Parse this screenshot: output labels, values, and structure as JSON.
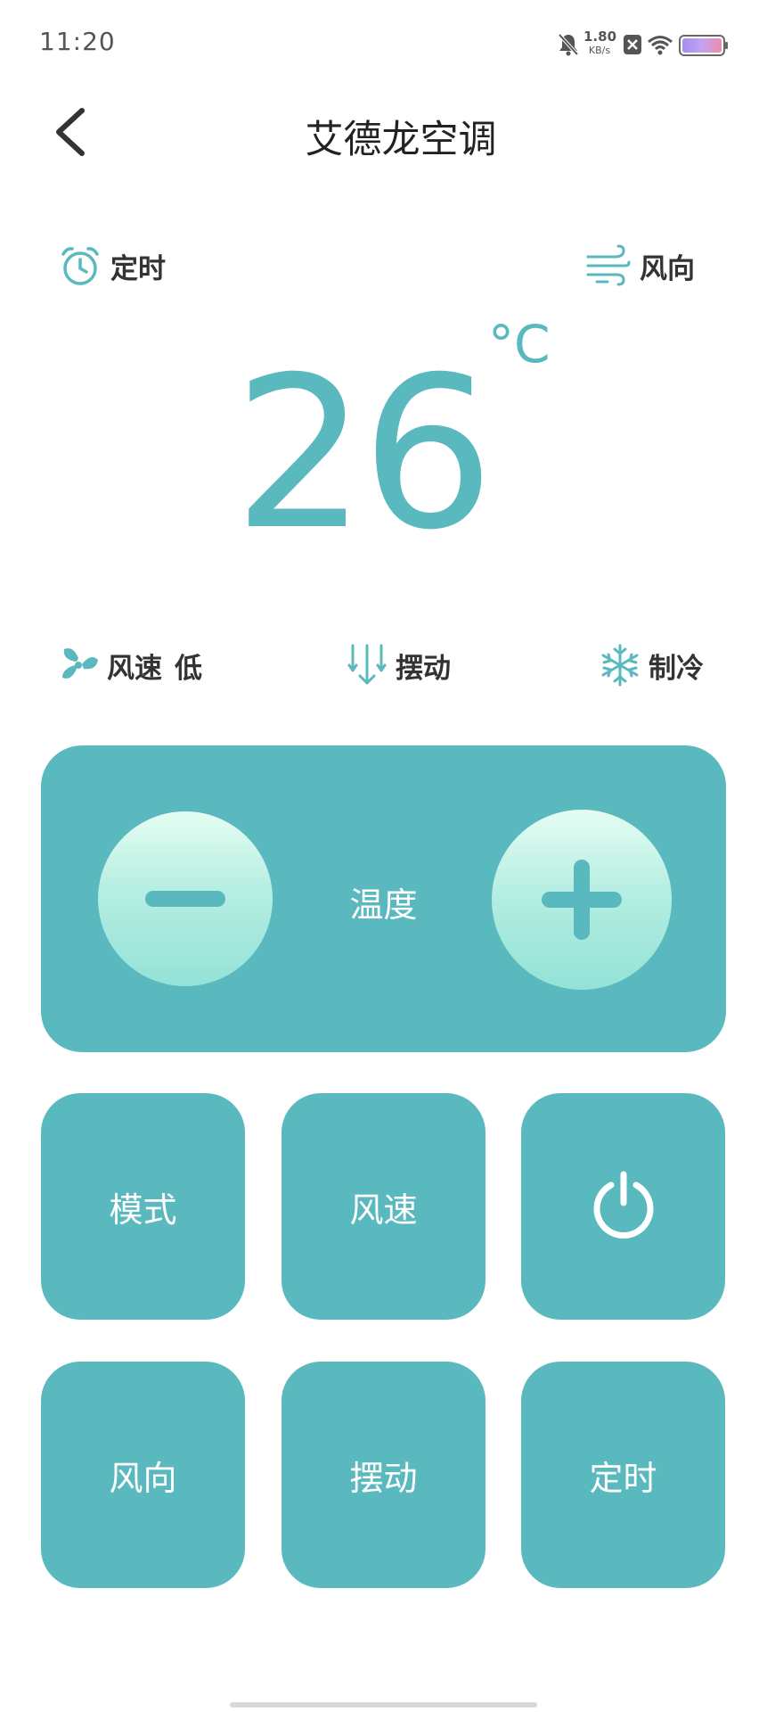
{
  "status_bar": {
    "time": "11:20",
    "net_speed_value": "1.80",
    "net_speed_unit": "KB/s",
    "icons": [
      "bell-muted-icon",
      "close-box-icon",
      "wifi-icon",
      "battery-icon"
    ]
  },
  "header": {
    "title": "艾德龙空调",
    "back_icon": "chevron-left-icon"
  },
  "top_controls": {
    "timer_label": "定时",
    "wind_direction_label": "风向"
  },
  "display": {
    "temperature": "26",
    "unit": "°C"
  },
  "status_row": {
    "fan_speed_label": "风速",
    "fan_speed_value": "低",
    "swing_label": "摆动",
    "mode_label": "制冷"
  },
  "temp_panel": {
    "label": "温度"
  },
  "buttons": {
    "mode": "模式",
    "fan_speed": "风速",
    "power_icon": "power-icon",
    "wind_direction": "风向",
    "swing": "摆动",
    "timer": "定时"
  },
  "colors": {
    "accent": "#5ab9be",
    "button_gradient_top": "#e5fdf2",
    "button_gradient_bottom": "#93e2d7"
  }
}
